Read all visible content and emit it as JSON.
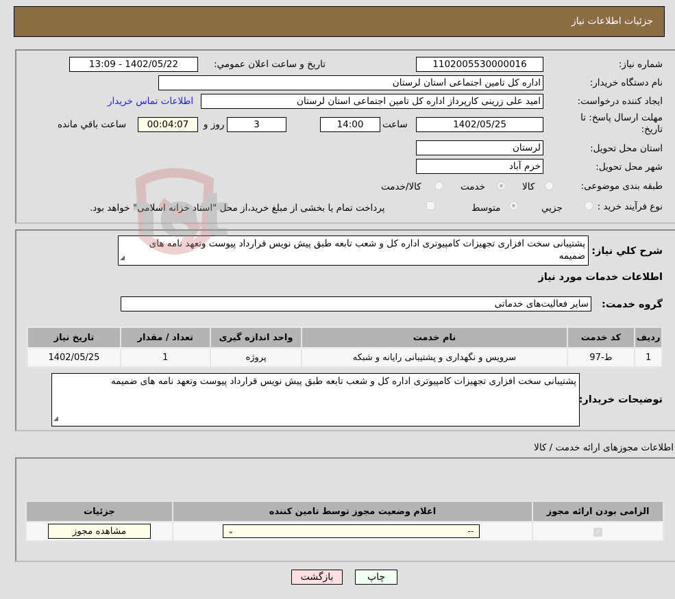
{
  "header": {
    "title": "جزئیات اطلاعات نیاز"
  },
  "details": {
    "need_number_label": "شماره نیاز:",
    "need_number": "1102005530000016",
    "announce_label": "تاریخ و ساعت اعلان عمومي:",
    "announce_value": "1402/05/22 - 13:09",
    "buyer_org_label": "نام دستگاه خریدار:",
    "buyer_org": "اداره کل تامین اجتماعی استان لرستان",
    "creator_label": "ایجاد کننده درخواست:",
    "creator": "امید علی زرینی کارپرداز اداره کل تامین اجتماعی استان لرستان",
    "contact_link": "اطلاعات تماس خریدار",
    "deadline_label_line1": "مهلت ارسال پاسخ: تا",
    "deadline_label_line2": "تاریخ:",
    "deadline_date": "1402/05/25",
    "time_label": "ساعت",
    "deadline_time": "14:00",
    "days_value": "3",
    "days_label": "روز و",
    "remaining_time": "00:04:07",
    "remaining_label": "ساعت باقي مانده",
    "province_label": "استان محل تحویل:",
    "province": "لرستان",
    "city_label": "شهر محل تحویل:",
    "city": "خرم آباد",
    "category_label": "طبقه بندی موضوعی:",
    "category_options": [
      {
        "label": "کالا",
        "checked": false
      },
      {
        "label": "خدمت",
        "checked": true
      },
      {
        "label": "کالا/خدمت",
        "checked": false
      }
    ],
    "purchase_type_label": "نوع فرآیند خرید :",
    "purchase_type_options": [
      {
        "label": "جزيي",
        "checked": false
      },
      {
        "label": "متوسط",
        "checked": true
      }
    ],
    "treasury_checkbox_label": "پرداخت تمام یا بخشی از مبلغ خرید،از محل \"اسناد خزانه اسلامی\" خواهد بود.",
    "treasury_checked": false
  },
  "need": {
    "description_label": "شرح کلي نیاز:",
    "description": "پشتیبانی سخت افزاری تجهیزات کامپیوتری اداره کل و شعب تابعه طبق پیش نویس قرارداد پیوست وتعهد نامه های ضمیمه",
    "services_heading": "اطلاعات خدمات مورد نیاز",
    "service_group_label": "گروه خدمت:",
    "service_group": "سایر فعالیت‌های خدماتی",
    "table": {
      "columns": [
        "ردیف",
        "کد خدمت",
        "نام خدمت",
        "واحد اندازه گیری",
        "تعداد / مقدار",
        "تاریخ نیاز"
      ],
      "rows": [
        [
          "1",
          "ط-97",
          "سرویس و نگهداری و پشتیبانی رایانه و شبکه",
          "پروژه",
          "1",
          "1402/05/25"
        ]
      ]
    },
    "buyer_notes_label": "توضیحات خریدار:",
    "buyer_notes": "پشتیبانی سخت افزاری تجهیزات کامپیوتری اداره کل و شعب تابعه طبق پیش نویس قرارداد پیوست وتعهد نامه های ضمیمه"
  },
  "permits": {
    "heading": "اطلاعات مجوزهای ارائه خدمت / کالا",
    "columns": [
      "الزامی بودن ارائه مجوز",
      "اعلام وضعیت مجوز توسط تامین کننده",
      "جزئیات"
    ],
    "row": {
      "required_checked": true,
      "status_selected": "--",
      "details_button": "مشاهده مجوز"
    }
  },
  "footer": {
    "print_button": "چاپ",
    "back_button": "بازگشت"
  },
  "watermark": "AriaTender.net"
}
